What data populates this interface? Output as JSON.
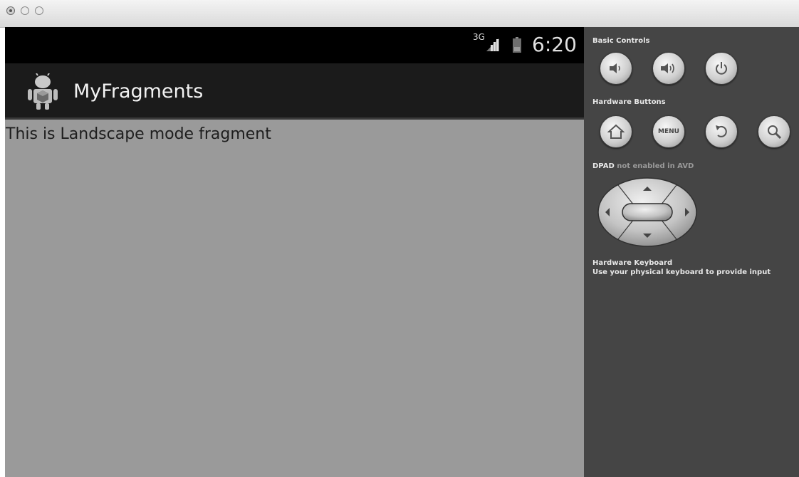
{
  "window": {
    "controls": [
      "close",
      "minimize",
      "zoom"
    ]
  },
  "status_bar": {
    "network": "3G",
    "icons": [
      "signal-icon",
      "battery-icon"
    ],
    "time": "6:20"
  },
  "action_bar": {
    "icon": "android-app-icon",
    "title": "MyFragments"
  },
  "content": {
    "text": "This is Landscape mode fragment"
  },
  "panel": {
    "basic_controls": {
      "label": "Basic Controls",
      "buttons": [
        "volume-down-icon",
        "volume-up-icon",
        "power-icon"
      ]
    },
    "hardware_buttons": {
      "label": "Hardware Buttons",
      "menu_label": "MENU",
      "buttons": [
        "home-icon",
        "menu",
        "back-icon",
        "search-icon"
      ]
    },
    "dpad": {
      "label": "DPAD",
      "note": "not enabled in AVD"
    },
    "keyboard": {
      "label": "Hardware Keyboard",
      "description": "Use your physical keyboard to provide input"
    }
  },
  "colors": {
    "screen_bg": "#9a9a9a",
    "status_bar": "#000000",
    "action_bar": "#1b1b1b",
    "panel_bg": "#454545"
  }
}
